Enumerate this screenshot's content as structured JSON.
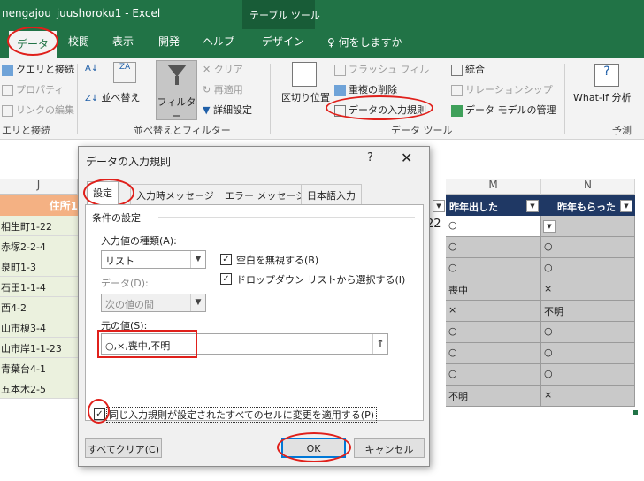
{
  "window": {
    "title": "nengajou_juushoroku1  -  Excel",
    "context_tab_group": "テーブル ツール"
  },
  "tabs": [
    {
      "label": "データ",
      "active": true
    },
    {
      "label": "校閲"
    },
    {
      "label": "表示"
    },
    {
      "label": "開発"
    },
    {
      "label": "ヘルプ"
    },
    {
      "label": "デザイン"
    }
  ],
  "tell_me": "何をしますか",
  "ribbon": {
    "connections": {
      "items": [
        "クエリと接続",
        "プロパティ",
        "リンクの編集"
      ],
      "group": "エリと接続"
    },
    "sort_filter": {
      "sort_label": "並べ替え",
      "filter_label": "フィルター",
      "clear": "クリア",
      "reapply": "再適用",
      "advanced": "詳細設定",
      "group": "並べ替えとフィルター"
    },
    "data_tools": {
      "text_to_columns": "区切り位置",
      "flash_fill": "フラッシュ フィル",
      "remove_duplicates": "重複の削除",
      "data_validation": "データの入力規則",
      "consolidate": "統合",
      "relationships": "リレーションシップ",
      "data_model": "データ モデルの管理",
      "group": "データ ツール"
    },
    "forecast": {
      "what_if": "What-If 分析",
      "group": "予測"
    }
  },
  "sheet": {
    "column_j": "J",
    "column_m": "M",
    "column_n": "N",
    "header_j": "住所1",
    "header_m": "昨年出した",
    "header_n": "昨年もらった",
    "stray_value": "22",
    "addresses": [
      "相生町1-22",
      "赤塚2-2-4",
      "泉町1-3",
      "石田1-1-4",
      "西4-2",
      "山市榎3-4",
      "山市岸1-1-23",
      "青葉台4-1",
      "五本木2-5"
    ],
    "col_m_values": [
      "○",
      "○",
      "○",
      "喪中",
      "×",
      "○",
      "○",
      "○",
      "不明"
    ],
    "col_n_values": [
      "",
      "○",
      "○",
      "×",
      "不明",
      "○",
      "○",
      "○",
      "×"
    ]
  },
  "dialog": {
    "title": "データの入力規則",
    "help": "?",
    "close": "✕",
    "tabs": [
      "設定",
      "入力時メッセージ",
      "エラー メッセージ",
      "日本語入力"
    ],
    "section": "条件の設定",
    "allow_label": "入力値の種類(A):",
    "allow_value": "リスト",
    "ignore_blank": "空白を無視する(B)",
    "in_cell_dropdown": "ドロップダウン リストから選択する(I)",
    "data_label": "データ(D):",
    "data_value": "次の値の間",
    "source_label": "元の値(S):",
    "source_value": "○,×,喪中,不明",
    "apply_all": "同じ入力規則が設定されたすべてのセルに変更を適用する(P)",
    "clear_all": "すべてクリア(C)",
    "ok": "OK",
    "cancel": "キャンセル",
    "check_mark": "✓"
  },
  "colors": {
    "excel_green": "#217346",
    "annotation_red": "#e0201b"
  }
}
